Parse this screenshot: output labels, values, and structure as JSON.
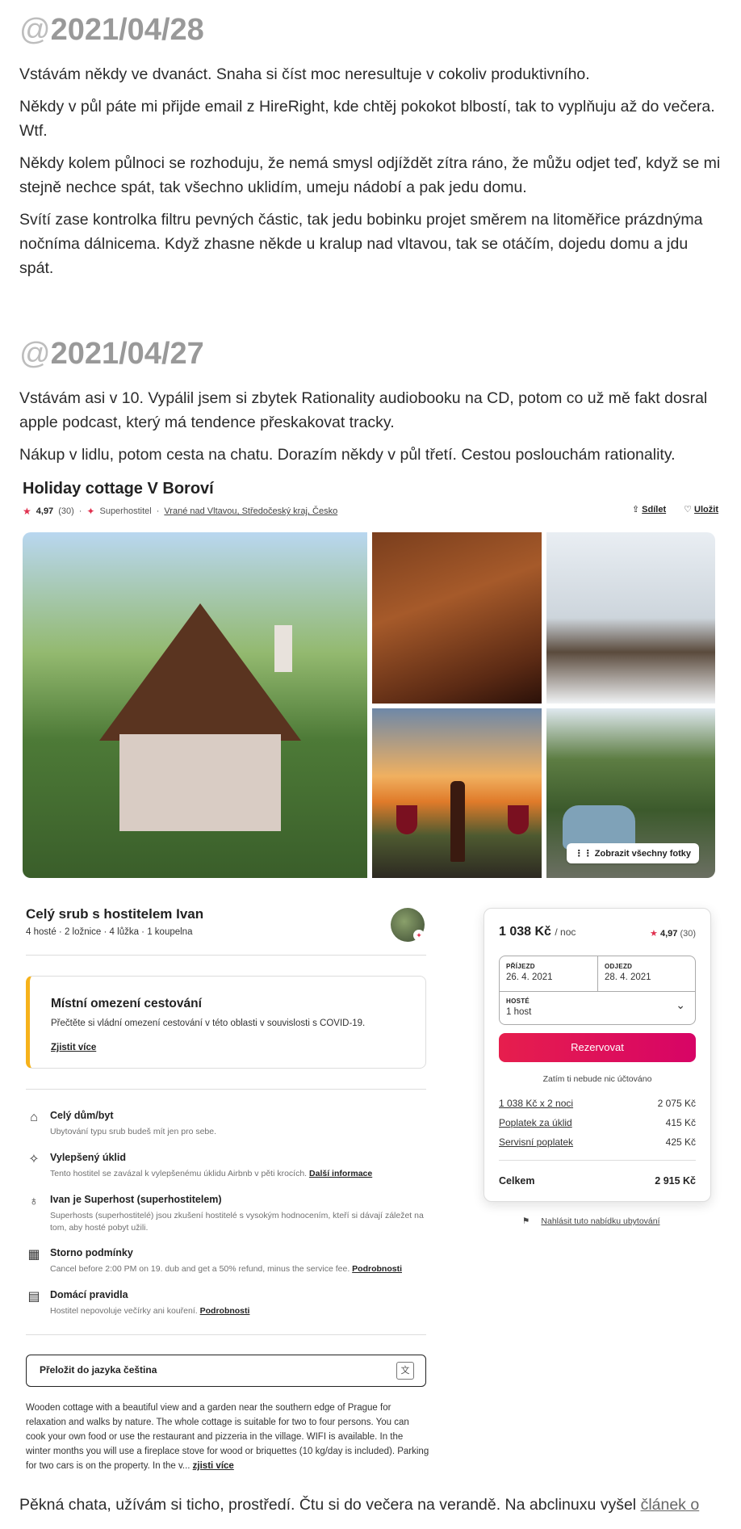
{
  "entries": [
    {
      "date": "2021/04/28",
      "paragraphs": [
        "Vstávám někdy ve dvanáct. Snaha si číst moc neresultuje v cokoliv produktivního.",
        "Někdy v půl páte mi přijde email z HireRight, kde chtěj pokokot blbostí, tak to vyplňuju až do večera. Wtf.",
        "Někdy kolem půlnoci se rozhoduju, že nemá smysl odjíždět zítra ráno, že můžu odjet teď, když se mi stejně nechce spát, tak všechno uklidím, umeju nádobí a pak jedu domu.",
        "Svítí zase kontrolka filtru pevných částic, tak jedu bobinku projet směrem na litoměřice prázdnýma nočníma dálnicema. Když zhasne někde u kralup nad vltavou, tak se otáčím, dojedu domu a jdu spát."
      ]
    },
    {
      "date": "2021/04/27",
      "paragraphs": [
        "Vstávám asi v 10. Vypálil jsem si zbytek Rationality audiobooku na CD, potom co už mě fakt dosral apple podcast, který má tendence přeskakovat tracky.",
        "Nákup v lidlu, potom cesta na chatu. Dorazím někdy v půl třetí. Cestou poslouchám rationality."
      ]
    }
  ],
  "at_sign": "@",
  "listing": {
    "title": "Holiday cottage V Boroví",
    "rating": "4,97",
    "reviews": "(30)",
    "superhost": "Superhostitel",
    "location": "Vrané nad Vltavou, Středočeský kraj, Česko",
    "share": "Sdílet",
    "save": "Uložit",
    "show_all_photos": "Zobrazit všechny fotky",
    "host_heading": "Celý srub s hostitelem Ivan",
    "host_sub": "4 hosté · 2 ložnice · 4 lůžka · 1 koupelna",
    "alert": {
      "title": "Místní omezení cestování",
      "text": "Přečtěte si vládní omezení cestování v této oblasti v souvislosti s COVID-19.",
      "link": "Zjistit více"
    },
    "features": [
      {
        "icon": "home-icon",
        "title": "Celý dům/byt",
        "desc": "Ubytování typu srub budeš mít jen pro sebe.",
        "link": ""
      },
      {
        "icon": "sparkle-icon",
        "title": "Vylepšený úklid",
        "desc": "Tento hostitel se zavázal k vylepšenému úklidu Airbnb v pěti krocích.",
        "link": "Další informace"
      },
      {
        "icon": "medal-icon",
        "title": "Ivan je Superhost (superhostitelem)",
        "desc": "Superhosts (superhostitelé) jsou zkušení hostitelé s vysokým hodnocením, kteří si dávají záležet na tom, aby hosté pobyt užili.",
        "link": ""
      },
      {
        "icon": "calendar-icon",
        "title": "Storno podmínky",
        "desc": "Cancel before 2:00 PM on 19. dub and get a 50% refund, minus the service fee.",
        "link": "Podrobnosti"
      },
      {
        "icon": "book-icon",
        "title": "Domácí pravidla",
        "desc": "Hostitel nepovoluje večírky ani kouření.",
        "link": "Podrobnosti"
      }
    ],
    "translate_label": "Přeložit do jazyka čeština",
    "description": "Wooden cottage with a beautiful view and a garden near the southern edge of Prague for relaxation and walks by nature. The whole cottage is suitable for two to four persons. You can cook your own food or use the restaurant and pizzeria in the village. WIFI is available. In the winter months you will use a fireplace stove for wood or briquettes (10 kg/day is included). Parking for two cars is on the property. In the v...",
    "description_link": "zjisti více",
    "booking": {
      "price": "1 038 Kč",
      "per": "/ noc",
      "rating": "4,97",
      "reviews": "(30)",
      "checkin_label": "PŘÍJEZD",
      "checkin": "26. 4. 2021",
      "checkout_label": "ODJEZD",
      "checkout": "28. 4. 2021",
      "guests_label": "HOSTÉ",
      "guests": "1 host",
      "reserve": "Rezervovat",
      "note": "Zatím ti nebude nic účtováno",
      "lines": [
        {
          "label": "1 038 Kč x 2 noci",
          "value": "2 075 Kč"
        },
        {
          "label": "Poplatek za úklid",
          "value": "415 Kč"
        },
        {
          "label": "Servisní poplatek",
          "value": "425 Kč"
        }
      ],
      "total_label": "Celkem",
      "total": "2 915 Kč"
    },
    "report": "Nahlásit tuto nabídku ubytování"
  },
  "final": {
    "text": "Pěkná chata, užívám si ticho, prostředí. Čtu si do večera na verandě. Na abclinuxu vyšel ",
    "link": "článek o "
  }
}
